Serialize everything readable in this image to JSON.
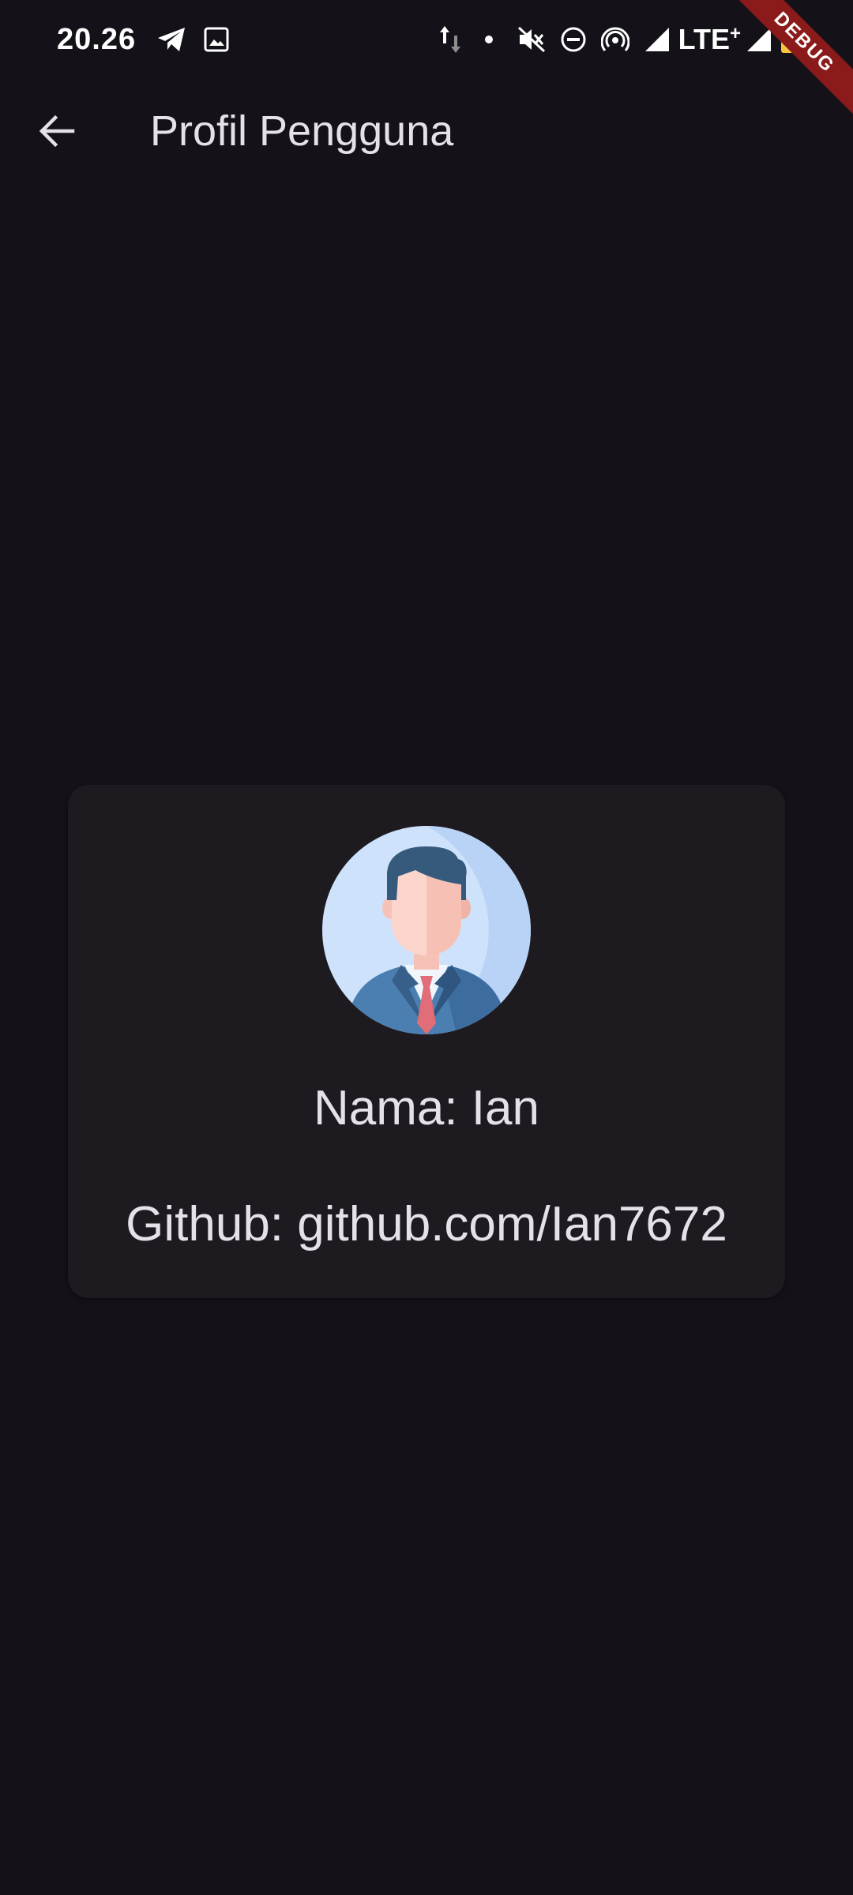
{
  "status_bar": {
    "time": "20.26",
    "network_label": "LTE",
    "network_suffix": "+",
    "icons": [
      "telegram-icon",
      "gallery-icon",
      "data-transfer-icon",
      "dot-icon",
      "mute-icon",
      "dnd-icon",
      "hotspot-icon",
      "signal-icon",
      "battery-icon"
    ]
  },
  "debug_banner": {
    "label": "DEBUG"
  },
  "app_bar": {
    "title": "Profil Pengguna",
    "back_icon": "arrow-left-icon"
  },
  "profile": {
    "name_text": "Nama: Ian",
    "github_text": "Github: github.com/Ian7672",
    "avatar_icon": "businessman-avatar-icon"
  },
  "colors": {
    "background": "#141218",
    "card": "#1d1b20",
    "text": "#e6e0e9",
    "debug": "#8b1a1a"
  }
}
